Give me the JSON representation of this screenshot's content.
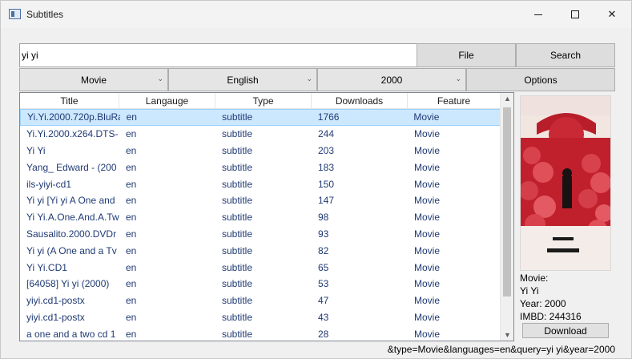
{
  "window": {
    "title": "Subtitles"
  },
  "search": {
    "value": "yi yi"
  },
  "buttons": {
    "file": "File",
    "search": "Search",
    "options": "Options",
    "download": "Download"
  },
  "filters": {
    "type": "Movie",
    "language": "English",
    "year": "2000"
  },
  "table": {
    "headers": [
      "Title",
      "Langauge",
      "Type",
      "Downloads",
      "Feature"
    ],
    "rows": [
      [
        "Yi.Yi.2000.720p.BluRa",
        "en",
        "subtitle",
        "1766",
        "Movie"
      ],
      [
        "Yi.Yi.2000.x264.DTS-",
        "en",
        "subtitle",
        "244",
        "Movie"
      ],
      [
        "Yi Yi",
        "en",
        "subtitle",
        "203",
        "Movie"
      ],
      [
        "Yang_ Edward - (200",
        "en",
        "subtitle",
        "183",
        "Movie"
      ],
      [
        "ils-yiyi-cd1",
        "en",
        "subtitle",
        "150",
        "Movie"
      ],
      [
        "Yi yi [Yi yi A One and",
        "en",
        "subtitle",
        "147",
        "Movie"
      ],
      [
        "Yi Yi.A.One.And.A.Tw",
        "en",
        "subtitle",
        "98",
        "Movie"
      ],
      [
        "Sausalito.2000.DVDr",
        "en",
        "subtitle",
        "93",
        "Movie"
      ],
      [
        "Yi yi (A One and a Tv",
        "en",
        "subtitle",
        "82",
        "Movie"
      ],
      [
        "Yi Yi.CD1",
        "en",
        "subtitle",
        "65",
        "Movie"
      ],
      [
        "[64058] Yi yi (2000)",
        "en",
        "subtitle",
        "53",
        "Movie"
      ],
      [
        "yiyi.cd1-postx",
        "en",
        "subtitle",
        "47",
        "Movie"
      ],
      [
        "yiyi.cd1-postx",
        "en",
        "subtitle",
        "43",
        "Movie"
      ],
      [
        "a one and a two cd 1",
        "en",
        "subtitle",
        "28",
        "Movie"
      ]
    ]
  },
  "details": {
    "movie_label": "Movie:",
    "movie_name": "Yi Yi",
    "year": "Year: 2000",
    "imdb": "IMBD: 244316"
  },
  "status": {
    "query": "&type=Movie&languages=en&query=yi yi&year=2000"
  },
  "colors": {
    "selected_row": "#cce8ff",
    "row_text": "#1f3a73",
    "poster_red": "#c0202c"
  }
}
